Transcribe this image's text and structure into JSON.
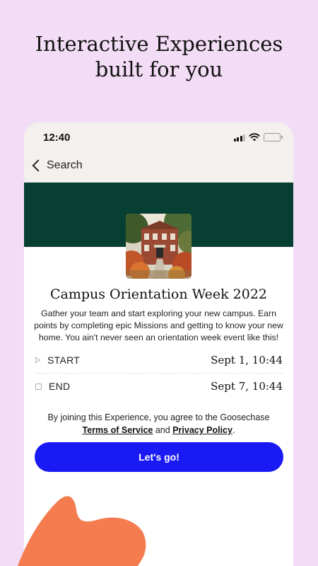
{
  "headline": {
    "line1": "Interactive Experiences",
    "line2": "built for you"
  },
  "status_bar": {
    "time": "12:40",
    "icons": [
      "signal-icon",
      "wifi-icon",
      "battery-icon"
    ]
  },
  "nav": {
    "back_label": "Search"
  },
  "event": {
    "title": "Campus Orientation Week 2022",
    "description": "Gather your team and start exploring your new campus. Earn points by completing epic Missions and getting to know your new home. You ain't never seen an orientation week event like this!",
    "start_label": "START",
    "start_value": "Sept 1, 10:44",
    "end_label": "END",
    "end_value": "Sept 7, 10:44"
  },
  "agreement": {
    "prefix": "By joining this Experience, you agree to the Goosechase",
    "terms": "Terms of Service",
    "and": "and",
    "privacy": "Privacy Policy",
    "suffix": "."
  },
  "cta": {
    "label": "Let's go!"
  },
  "colors": {
    "background": "#f3dcf5",
    "banner": "#073f33",
    "button": "#1a1af5",
    "blob": "#f47c4e"
  }
}
